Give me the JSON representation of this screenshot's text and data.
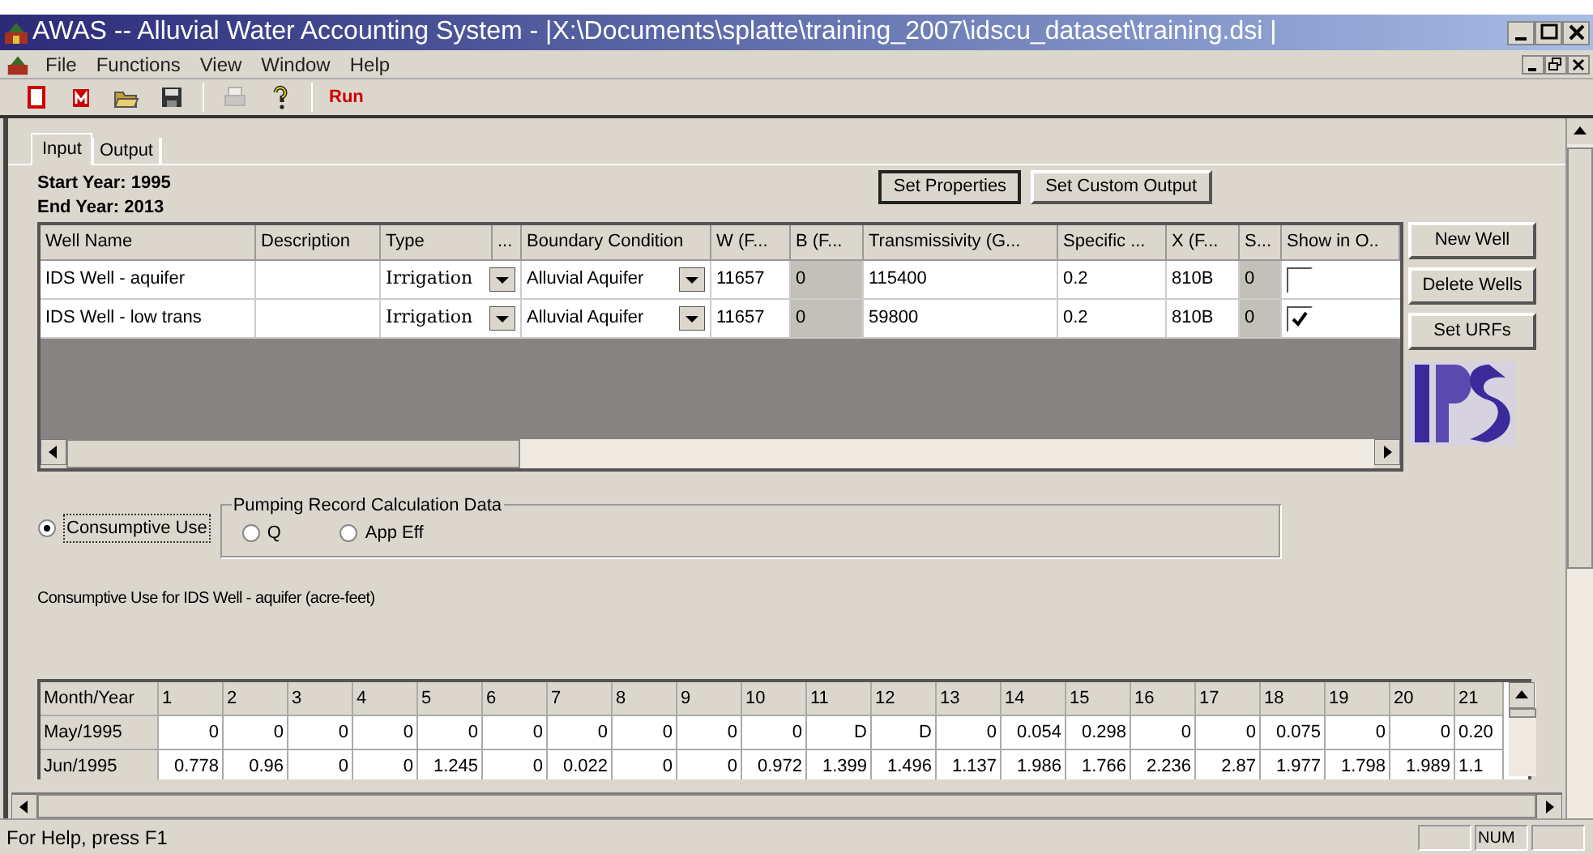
{
  "window": {
    "title": "AWAS -- Alluvial Water Accounting System - |X:\\Documents\\splatte\\training_2007\\idscu_dataset\\training.dsi |"
  },
  "menu": [
    "File",
    "Functions",
    "View",
    "Window",
    "Help"
  ],
  "toolbar": [
    {
      "kind": "new"
    },
    {
      "kind": "model"
    },
    {
      "kind": "open"
    },
    {
      "kind": "save"
    },
    {
      "kind": "sep"
    },
    {
      "kind": "print",
      "disabled": true
    },
    {
      "kind": "help"
    },
    {
      "kind": "sep"
    },
    {
      "kind": "run",
      "label": "Run"
    }
  ],
  "tabs": [
    {
      "label": "Input",
      "selected": true
    },
    {
      "label": "Output",
      "selected": false
    }
  ],
  "start_year": "Start Year: 1995",
  "end_year": "End Year: 2013",
  "top_buttons": [
    {
      "label": "Set Properties",
      "focused": true
    },
    {
      "label": "Set Custom Output",
      "focused": false
    }
  ],
  "wells": {
    "columns": [
      "Well Name",
      "Description",
      "Type",
      "...",
      "Boundary Condition",
      "W (F...",
      "B (F...",
      "Transmissivity (G...",
      "Specific ...",
      "X (F...",
      "S...",
      "Show in O.."
    ],
    "rows": [
      {
        "name": "IDS Well - aquifer",
        "description": "",
        "type": "Irrigation",
        "boundary": "Alluvial Aquifer",
        "w": "11657",
        "b": "0",
        "transmissivity": "115400",
        "specific": "0.2",
        "x": "810B",
        "s": "0",
        "show": false
      },
      {
        "name": "IDS Well - low trans",
        "description": "",
        "type": "Irrigation",
        "boundary": "Alluvial Aquifer",
        "w": "11657",
        "b": "0",
        "transmissivity": "59800",
        "specific": "0.2",
        "x": "810B",
        "s": "0",
        "show": true
      }
    ]
  },
  "side_buttons": [
    "New Well",
    "Delete Wells",
    "Set URFs"
  ],
  "mode_radios": [
    {
      "label": "Consumptive Use",
      "selected": true
    }
  ],
  "pumping_group": {
    "title": "Pumping Record Calculation Data",
    "radios": [
      {
        "label": "Q",
        "selected": false
      },
      {
        "label": "App Eff",
        "selected": false
      }
    ]
  },
  "use_caption": "Consumptive Use for IDS Well - aquifer (acre-feet)",
  "use_table": {
    "columns": [
      "Month/Year",
      "1",
      "2",
      "3",
      "4",
      "5",
      "6",
      "7",
      "8",
      "9",
      "10",
      "11",
      "12",
      "13",
      "14",
      "15",
      "16",
      "17",
      "18",
      "19",
      "20",
      "21"
    ],
    "rows": [
      [
        "May/1995",
        "0",
        "0",
        "0",
        "0",
        "0",
        "0",
        "0",
        "0",
        "0",
        "0",
        "D",
        "D",
        "0",
        "0.054",
        "0.298",
        "0",
        "0",
        "0.075",
        "0",
        "0",
        "0.20"
      ],
      [
        "Jun/1995",
        "0.778",
        "0.96",
        "0",
        "0",
        "1.245",
        "0",
        "0.022",
        "0",
        "0",
        "0.972",
        "1.399",
        "1.496",
        "1.137",
        "1.986",
        "1.766",
        "2.236",
        "2.87",
        "1.977",
        "1.798",
        "1.989",
        "1.1"
      ]
    ]
  },
  "status_bar": {
    "text": "For Help, press F1",
    "num_indicator": "NUM"
  }
}
